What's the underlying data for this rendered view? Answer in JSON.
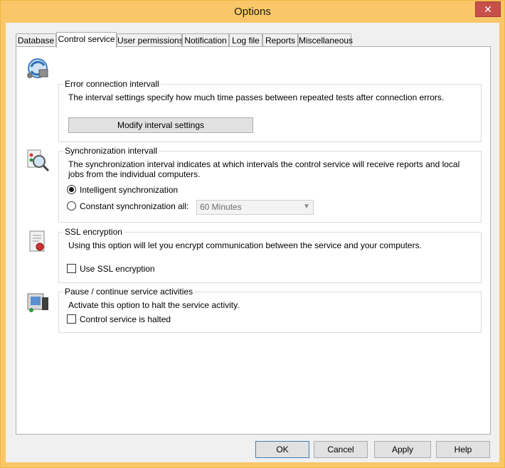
{
  "window": {
    "title": "Options",
    "close_label": "✕"
  },
  "tabs": [
    {
      "label": "Database",
      "active": false
    },
    {
      "label": "Control service",
      "active": true
    },
    {
      "label": "User permissions",
      "active": false
    },
    {
      "label": "Notification",
      "active": false
    },
    {
      "label": "Log file",
      "active": false
    },
    {
      "label": "Reports",
      "active": false
    },
    {
      "label": "Miscellaneous",
      "active": false
    }
  ],
  "error_connection": {
    "title": "Error connection intervall",
    "description": "The interval settings specify how much time passes between repeated tests after connection errors.",
    "button": "Modify interval settings"
  },
  "synchronization": {
    "title": "Synchronization intervall",
    "description": "The synchronization interval indicates at which intervals the control service will receive reports and local jobs from the individual computers.",
    "option_intelligent": "Intelligent synchronization",
    "option_constant": "Constant synchronization all:",
    "selected": "intelligent",
    "interval_value": "60 Minutes"
  },
  "ssl": {
    "title": "SSL encryption",
    "description": "Using this option will let you encrypt communication between the service and your computers.",
    "checkbox_label": "Use SSL encryption",
    "checked": false
  },
  "pause": {
    "title": "Pause / continue service activities",
    "description": "Activate this option to halt the service activity.",
    "checkbox_label": "Control service is halted",
    "checked": false
  },
  "footer": {
    "ok": "OK",
    "cancel": "Cancel",
    "apply": "Apply",
    "help": "Help"
  },
  "icons": {
    "error_connection": "network-refresh-icon",
    "synchronization": "search-sync-icon",
    "ssl": "certificate-icon",
    "pause": "computer-pause-icon"
  }
}
